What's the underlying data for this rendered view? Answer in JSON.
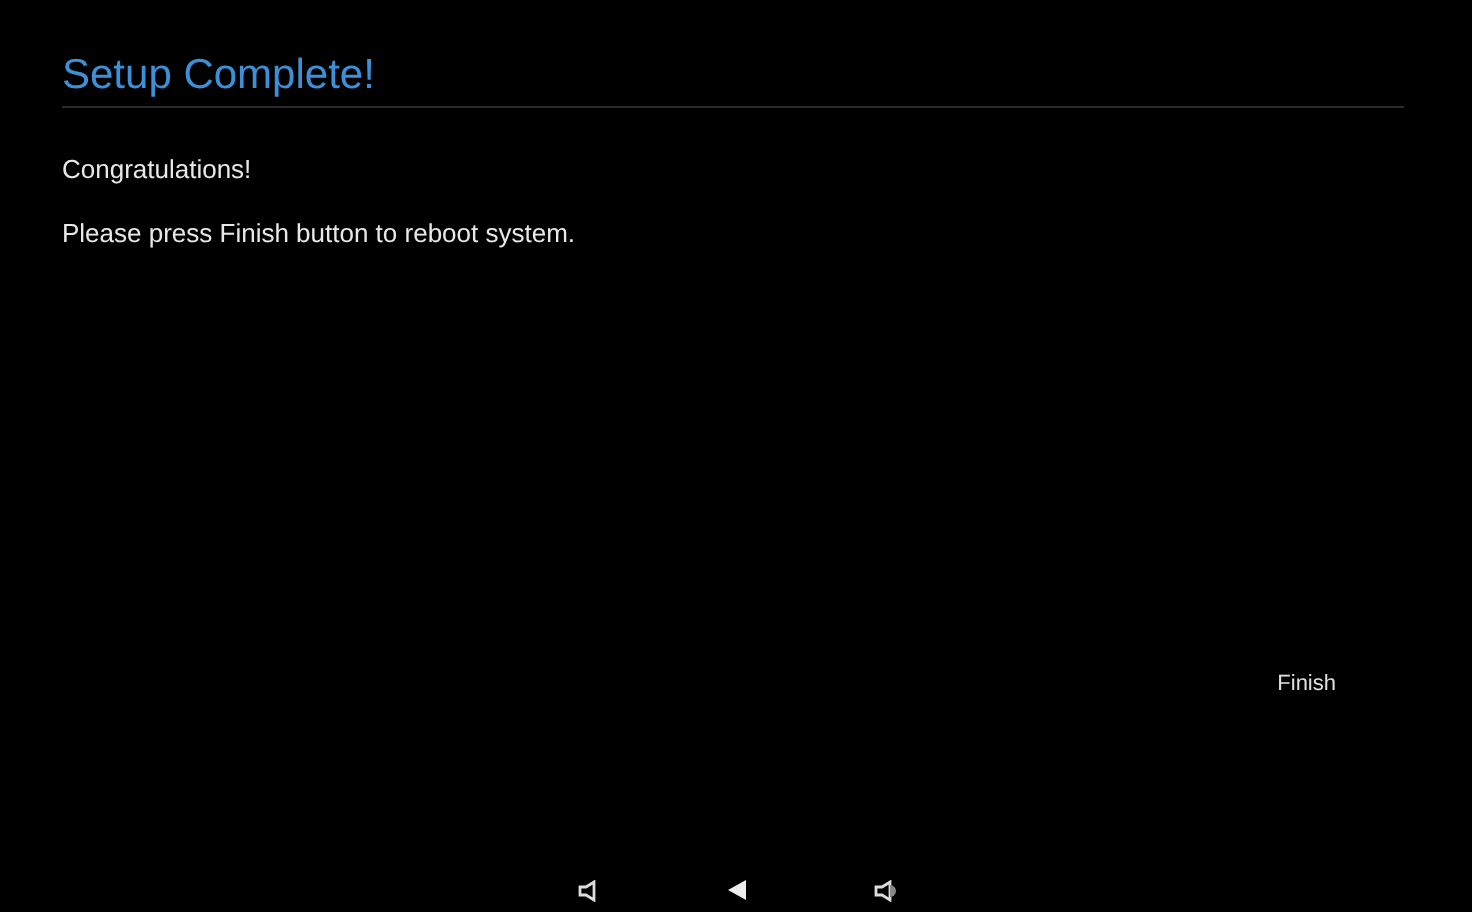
{
  "title": "Setup Complete!",
  "paragraphs": [
    "Congratulations!",
    "Please press Finish button to reboot system."
  ],
  "finish_button": "Finish"
}
